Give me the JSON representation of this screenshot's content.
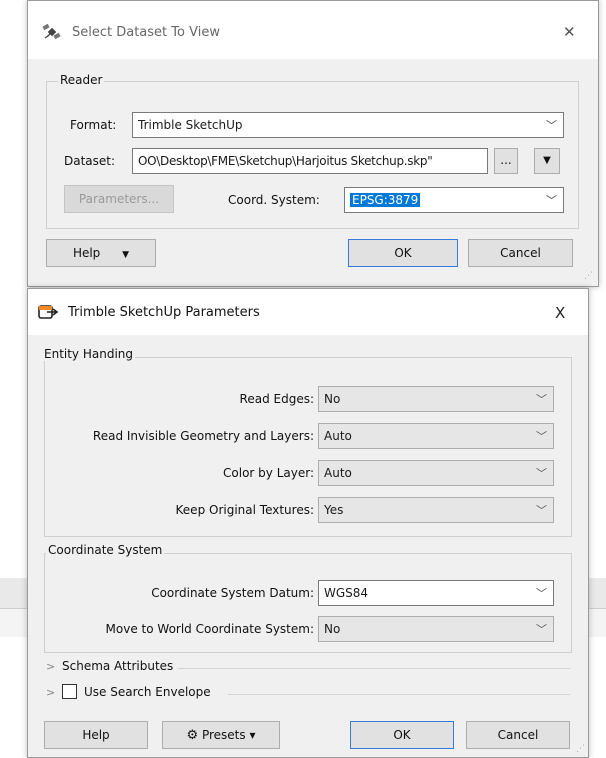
{
  "reader_dialog": {
    "title": "Select Dataset To View",
    "close_glyph": "✕",
    "reader_group": "Reader",
    "format_label": "Format:",
    "format_value": "Trimble SketchUp",
    "dataset_label": "Dataset:",
    "dataset_value": "OO\\Desktop\\FME\\Sketchup\\Harjoitus Sketchup.skp\"",
    "browse_label": "...",
    "dropdown_glyph": "▼",
    "parameters_label": "Parameters...",
    "coord_label": "Coord. System:",
    "coord_value": "EPSG:3879",
    "help_label": "Help",
    "help_dropdown_glyph": "▼",
    "ok_label": "OK",
    "cancel_label": "Cancel"
  },
  "params_dialog": {
    "title": "Trimble SketchUp Parameters",
    "close_glyph": "X",
    "entity_group": "Entity Handing",
    "read_edges_label": "Read Edges:",
    "read_edges_value": "No",
    "read_invisible_label": "Read Invisible Geometry and Layers:",
    "read_invisible_value": "Auto",
    "color_by_layer_label": "Color by Layer:",
    "color_by_layer_value": "Auto",
    "keep_textures_label": "Keep Original Textures:",
    "keep_textures_value": "Yes",
    "coord_group": "Coordinate System",
    "datum_label": "Coordinate System Datum:",
    "datum_value": "WGS84",
    "move_world_label": "Move to World Coordinate System:",
    "move_world_value": "No",
    "schema_attributes_label": "Schema Attributes",
    "search_envelope_label": "Use Search Envelope",
    "expand_glyph": ">",
    "help_label": "Help",
    "presets_label": "Presets",
    "presets_glyph": "▾",
    "ok_label": "OK",
    "cancel_label": "Cancel"
  },
  "colors": {
    "selection": "#0078d7",
    "dialog_bg": "#f0f0f0",
    "app_accent": "#f08a24"
  },
  "icons": {
    "reader_title_icon": "satellite-icon",
    "params_title_icon": "reader-arrow-icon",
    "presets_icon": "gear-icon"
  }
}
